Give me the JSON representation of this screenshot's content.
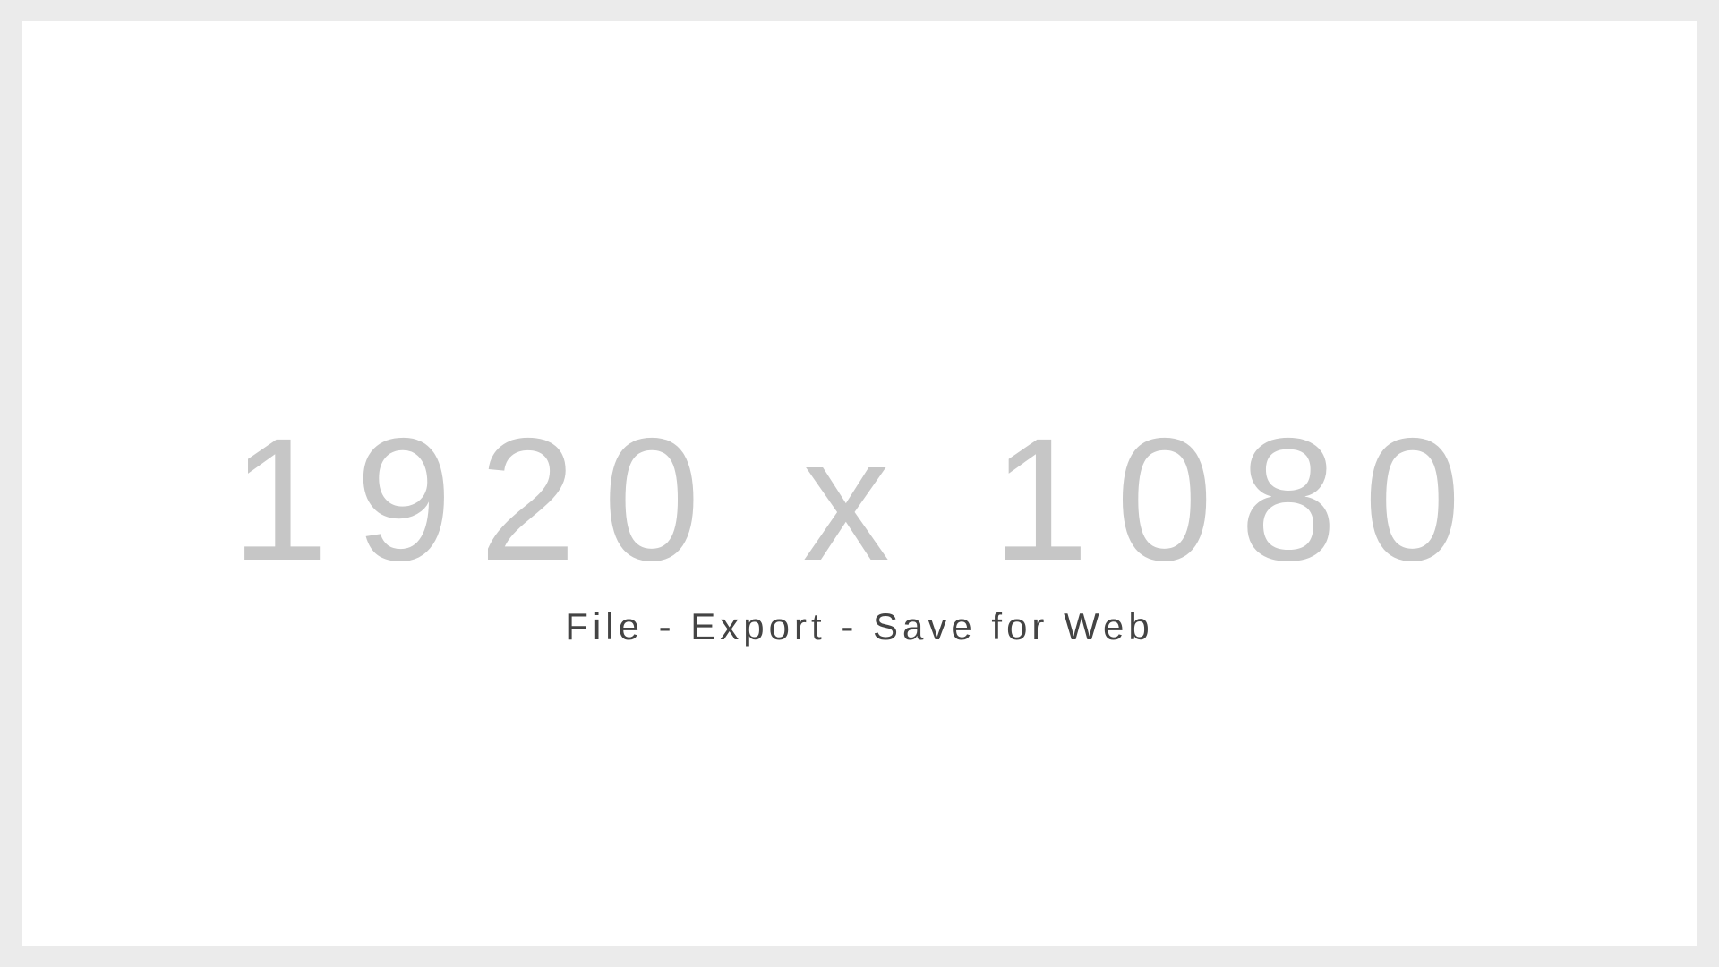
{
  "placeholder": {
    "dimensions_text": "1920 x 1080",
    "instructions_text": "File - Export - Save for Web"
  },
  "colors": {
    "frame_background": "#ebebeb",
    "canvas_background": "#ffffff",
    "dimensions_text": "#c6c6c6",
    "instructions_text": "#444444"
  }
}
